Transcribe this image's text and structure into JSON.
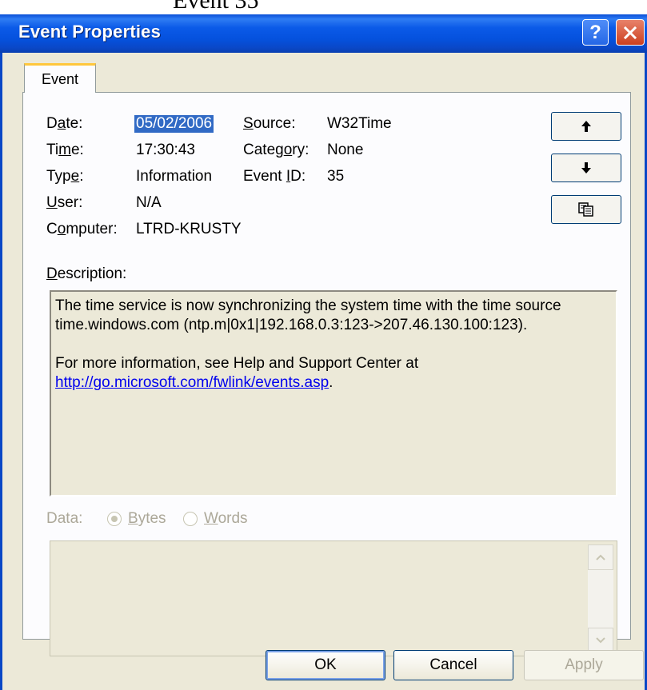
{
  "page_top_text": "Event 35",
  "window": {
    "title": "Event Properties",
    "help_glyph": "?",
    "close_glyph": "✕"
  },
  "tabs": [
    {
      "label": "Event",
      "active": true
    }
  ],
  "fields": {
    "date_label": "Date:",
    "date_value": "05/02/2006",
    "source_label": "Source:",
    "source_value": "W32Time",
    "time_label": "Time:",
    "time_value": "17:30:43",
    "category_label": "Category:",
    "category_value": "None",
    "type_label": "Type:",
    "type_value": "Information",
    "event_id_label": "Event ID:",
    "event_id_value": "35",
    "user_label": "User:",
    "user_value": "N/A",
    "computer_label": "Computer:",
    "computer_value": "LTRD-KRUSTY"
  },
  "nav_buttons": {
    "up_glyph": "🡅",
    "down_glyph": "🡇",
    "copy_icon": "copy-icon"
  },
  "description": {
    "label": "Description:",
    "line1": "The time service is now synchronizing the system time with the time source",
    "line2": "time.windows.com (ntp.m|0x1|192.168.0.3:123->207.46.130.100:123).",
    "line3": "For more information, see Help and Support Center at",
    "link": "http://go.microsoft.com/fwlink/events.asp",
    "link_suffix": "."
  },
  "data_section": {
    "label": "Data:",
    "options": [
      {
        "label": "Bytes",
        "checked": true
      },
      {
        "label": "Words",
        "checked": false
      }
    ],
    "content": ""
  },
  "footer": {
    "ok_label": "OK",
    "cancel_label": "Cancel",
    "apply_label": "Apply"
  },
  "colors": {
    "titlebar": "#0551dd",
    "tab_accent": "#ffc73c",
    "selection": "#316ac5",
    "link": "#0000ee",
    "dialog_face": "#ece9d8"
  }
}
